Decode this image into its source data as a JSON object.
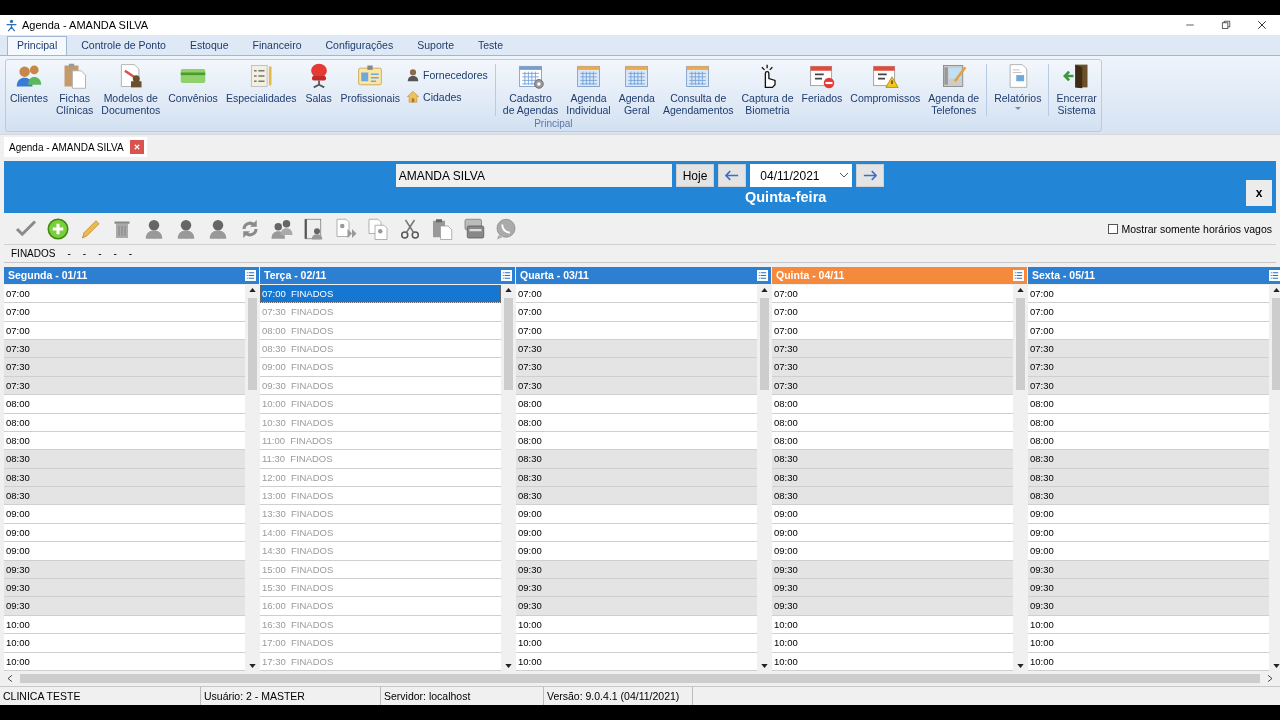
{
  "window": {
    "title": "Agenda - AMANDA SILVA"
  },
  "ribbon": {
    "tabs": [
      {
        "label": "Principal",
        "selected": true
      },
      {
        "label": "Controle de Ponto",
        "selected": false
      },
      {
        "label": "Estoque",
        "selected": false
      },
      {
        "label": "Financeiro",
        "selected": false
      },
      {
        "label": "Configurações",
        "selected": false
      },
      {
        "label": "Suporte",
        "selected": false
      },
      {
        "label": "Teste",
        "selected": false
      }
    ],
    "group_label": "Principal",
    "sections": [
      [
        {
          "label": "Clientes",
          "kind": "large"
        },
        {
          "label": "Fichas\nClínicas",
          "kind": "large"
        },
        {
          "label": "Modelos de\nDocumentos",
          "kind": "large"
        },
        {
          "label": "Convênios",
          "kind": "large"
        },
        {
          "label": "Especialidades",
          "kind": "large"
        },
        {
          "label": "Salas",
          "kind": "large"
        },
        {
          "label": "Profissionais",
          "kind": "large"
        },
        {
          "label": "Fornecedores",
          "kind": "small"
        },
        {
          "label": "Cidades",
          "kind": "small"
        }
      ],
      [
        {
          "label": "Cadastro\nde Agendas",
          "kind": "large"
        },
        {
          "label": "Agenda\nIndividual",
          "kind": "large"
        },
        {
          "label": "Agenda\nGeral",
          "kind": "large"
        },
        {
          "label": "Consulta de\nAgendamentos",
          "kind": "large"
        },
        {
          "label": "Captura de\nBiometria",
          "kind": "large"
        },
        {
          "label": "Feriados",
          "kind": "large"
        },
        {
          "label": "Compromissos",
          "kind": "large"
        },
        {
          "label": "Agenda de\nTelefones",
          "kind": "large"
        }
      ],
      [
        {
          "label": "Relatórios",
          "kind": "dropdown"
        }
      ],
      [
        {
          "label": "Encerrar\nSistema",
          "kind": "large"
        }
      ]
    ]
  },
  "document_tabs": [
    {
      "label": "Agenda - AMANDA SILVA",
      "selected": true
    }
  ],
  "agenda": {
    "professional": "AMANDA SILVA",
    "today_button": "Hoje",
    "date": "04/11/2021",
    "weekday": "Quinta-feira",
    "close_button": "x",
    "free_only": {
      "label": "Mostrar somente horários vagos",
      "checked": false
    },
    "info_line": [
      "FINADOS",
      "-",
      "-",
      "-",
      "-",
      "-"
    ],
    "days": [
      {
        "title": "Segunda - 01/11",
        "today": false,
        "rows": [
          {
            "time": "07:00",
            "shaded": false,
            "selected": false
          },
          {
            "time": "07:00",
            "shaded": false,
            "selected": false
          },
          {
            "time": "07:00",
            "shaded": false,
            "selected": false
          },
          {
            "time": "07:30",
            "shaded": true,
            "selected": false
          },
          {
            "time": "07:30",
            "shaded": true,
            "selected": false
          },
          {
            "time": "07:30",
            "shaded": true,
            "selected": false
          },
          {
            "time": "08:00",
            "shaded": false,
            "selected": false
          },
          {
            "time": "08:00",
            "shaded": false,
            "selected": false
          },
          {
            "time": "08:00",
            "shaded": false,
            "selected": false
          },
          {
            "time": "08:30",
            "shaded": true,
            "selected": false
          },
          {
            "time": "08:30",
            "shaded": true,
            "selected": false
          },
          {
            "time": "08:30",
            "shaded": true,
            "selected": false
          },
          {
            "time": "09:00",
            "shaded": false,
            "selected": false
          },
          {
            "time": "09:00",
            "shaded": false,
            "selected": false
          },
          {
            "time": "09:00",
            "shaded": false,
            "selected": false
          },
          {
            "time": "09:30",
            "shaded": true,
            "selected": false
          },
          {
            "time": "09:30",
            "shaded": true,
            "selected": false
          },
          {
            "time": "09:30",
            "shaded": true,
            "selected": false
          },
          {
            "time": "10:00",
            "shaded": false,
            "selected": false
          },
          {
            "time": "10:00",
            "shaded": false,
            "selected": false
          },
          {
            "time": "10:00",
            "shaded": false,
            "selected": false
          }
        ]
      },
      {
        "title": "Terça - 02/11",
        "today": false,
        "rows": [
          {
            "time": "07:00",
            "text": "FINADOS",
            "shaded": false,
            "blocked": true,
            "selected": true
          },
          {
            "time": "07:30",
            "text": "FINADOS",
            "shaded": false,
            "blocked": true,
            "selected": false
          },
          {
            "time": "08:00",
            "text": "FINADOS",
            "shaded": false,
            "blocked": true,
            "selected": false
          },
          {
            "time": "08:30",
            "text": "FINADOS",
            "shaded": false,
            "blocked": true,
            "selected": false
          },
          {
            "time": "09:00",
            "text": "FINADOS",
            "shaded": false,
            "blocked": true,
            "selected": false
          },
          {
            "time": "09:30",
            "text": "FINADOS",
            "shaded": false,
            "blocked": true,
            "selected": false
          },
          {
            "time": "10:00",
            "text": "FINADOS",
            "shaded": false,
            "blocked": true,
            "selected": false
          },
          {
            "time": "10:30",
            "text": "FINADOS",
            "shaded": false,
            "blocked": true,
            "selected": false
          },
          {
            "time": "11:00",
            "text": "FINADOS",
            "shaded": false,
            "blocked": true,
            "selected": false
          },
          {
            "time": "11:30",
            "text": "FINADOS",
            "shaded": false,
            "blocked": true,
            "selected": false
          },
          {
            "time": "12:00",
            "text": "FINADOS",
            "shaded": false,
            "blocked": true,
            "selected": false
          },
          {
            "time": "13:00",
            "text": "FINADOS",
            "shaded": false,
            "blocked": true,
            "selected": false
          },
          {
            "time": "13:30",
            "text": "FINADOS",
            "shaded": false,
            "blocked": true,
            "selected": false
          },
          {
            "time": "14:00",
            "text": "FINADOS",
            "shaded": false,
            "blocked": true,
            "selected": false
          },
          {
            "time": "14:30",
            "text": "FINADOS",
            "shaded": false,
            "blocked": true,
            "selected": false
          },
          {
            "time": "15:00",
            "text": "FINADOS",
            "shaded": false,
            "blocked": true,
            "selected": false
          },
          {
            "time": "15:30",
            "text": "FINADOS",
            "shaded": false,
            "blocked": true,
            "selected": false
          },
          {
            "time": "16:00",
            "text": "FINADOS",
            "shaded": false,
            "blocked": true,
            "selected": false
          },
          {
            "time": "16:30",
            "text": "FINADOS",
            "shaded": false,
            "blocked": true,
            "selected": false
          },
          {
            "time": "17:00",
            "text": "FINADOS",
            "shaded": false,
            "blocked": true,
            "selected": false
          },
          {
            "time": "17:30",
            "text": "FINADOS",
            "shaded": false,
            "blocked": true,
            "selected": false
          }
        ]
      },
      {
        "title": "Quarta - 03/11",
        "today": false,
        "rows": [
          {
            "time": "07:00",
            "shaded": false,
            "selected": false
          },
          {
            "time": "07:00",
            "shaded": false,
            "selected": false
          },
          {
            "time": "07:00",
            "shaded": false,
            "selected": false
          },
          {
            "time": "07:30",
            "shaded": true,
            "selected": false
          },
          {
            "time": "07:30",
            "shaded": true,
            "selected": false
          },
          {
            "time": "07:30",
            "shaded": true,
            "selected": false
          },
          {
            "time": "08:00",
            "shaded": false,
            "selected": false
          },
          {
            "time": "08:00",
            "shaded": false,
            "selected": false
          },
          {
            "time": "08:00",
            "shaded": false,
            "selected": false
          },
          {
            "time": "08:30",
            "shaded": true,
            "selected": false
          },
          {
            "time": "08:30",
            "shaded": true,
            "selected": false
          },
          {
            "time": "08:30",
            "shaded": true,
            "selected": false
          },
          {
            "time": "09:00",
            "shaded": false,
            "selected": false
          },
          {
            "time": "09:00",
            "shaded": false,
            "selected": false
          },
          {
            "time": "09:00",
            "shaded": false,
            "selected": false
          },
          {
            "time": "09:30",
            "shaded": true,
            "selected": false
          },
          {
            "time": "09:30",
            "shaded": true,
            "selected": false
          },
          {
            "time": "09:30",
            "shaded": true,
            "selected": false
          },
          {
            "time": "10:00",
            "shaded": false,
            "selected": false
          },
          {
            "time": "10:00",
            "shaded": false,
            "selected": false
          },
          {
            "time": "10:00",
            "shaded": false,
            "selected": false
          }
        ]
      },
      {
        "title": "Quinta - 04/11",
        "today": true,
        "rows": [
          {
            "time": "07:00",
            "shaded": false,
            "selected": false
          },
          {
            "time": "07:00",
            "shaded": false,
            "selected": false
          },
          {
            "time": "07:00",
            "shaded": false,
            "selected": false
          },
          {
            "time": "07:30",
            "shaded": true,
            "selected": false
          },
          {
            "time": "07:30",
            "shaded": true,
            "selected": false
          },
          {
            "time": "07:30",
            "shaded": true,
            "selected": false
          },
          {
            "time": "08:00",
            "shaded": false,
            "selected": false
          },
          {
            "time": "08:00",
            "shaded": false,
            "selected": false
          },
          {
            "time": "08:00",
            "shaded": false,
            "selected": false
          },
          {
            "time": "08:30",
            "shaded": true,
            "selected": false
          },
          {
            "time": "08:30",
            "shaded": true,
            "selected": false
          },
          {
            "time": "08:30",
            "shaded": true,
            "selected": false
          },
          {
            "time": "09:00",
            "shaded": false,
            "selected": false
          },
          {
            "time": "09:00",
            "shaded": false,
            "selected": false
          },
          {
            "time": "09:00",
            "shaded": false,
            "selected": false
          },
          {
            "time": "09:30",
            "shaded": true,
            "selected": false
          },
          {
            "time": "09:30",
            "shaded": true,
            "selected": false
          },
          {
            "time": "09:30",
            "shaded": true,
            "selected": false
          },
          {
            "time": "10:00",
            "shaded": false,
            "selected": false
          },
          {
            "time": "10:00",
            "shaded": false,
            "selected": false
          },
          {
            "time": "10:00",
            "shaded": false,
            "selected": false
          }
        ]
      },
      {
        "title": "Sexta - 05/11",
        "today": false,
        "rows": [
          {
            "time": "07:00",
            "shaded": false,
            "selected": false
          },
          {
            "time": "07:00",
            "shaded": false,
            "selected": false
          },
          {
            "time": "07:00",
            "shaded": false,
            "selected": false
          },
          {
            "time": "07:30",
            "shaded": true,
            "selected": false
          },
          {
            "time": "07:30",
            "shaded": true,
            "selected": false
          },
          {
            "time": "07:30",
            "shaded": true,
            "selected": false
          },
          {
            "time": "08:00",
            "shaded": false,
            "selected": false
          },
          {
            "time": "08:00",
            "shaded": false,
            "selected": false
          },
          {
            "time": "08:00",
            "shaded": false,
            "selected": false
          },
          {
            "time": "08:30",
            "shaded": true,
            "selected": false
          },
          {
            "time": "08:30",
            "shaded": true,
            "selected": false
          },
          {
            "time": "08:30",
            "shaded": true,
            "selected": false
          },
          {
            "time": "09:00",
            "shaded": false,
            "selected": false
          },
          {
            "time": "09:00",
            "shaded": false,
            "selected": false
          },
          {
            "time": "09:00",
            "shaded": false,
            "selected": false
          },
          {
            "time": "09:30",
            "shaded": true,
            "selected": false
          },
          {
            "time": "09:30",
            "shaded": true,
            "selected": false
          },
          {
            "time": "09:30",
            "shaded": true,
            "selected": false
          },
          {
            "time": "10:00",
            "shaded": false,
            "selected": false
          },
          {
            "time": "10:00",
            "shaded": false,
            "selected": false
          },
          {
            "time": "10:00",
            "shaded": false,
            "selected": false
          }
        ]
      }
    ]
  },
  "status_bar": [
    "CLINICA TESTE",
    "Usuário: 2 - MASTER",
    "Servidor: localhost",
    "Versão: 9.0.4.1 (04/11/2021)"
  ]
}
